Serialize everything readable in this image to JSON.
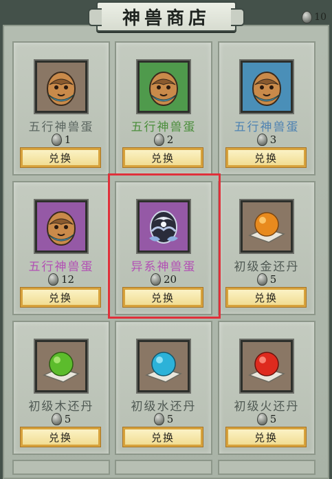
{
  "header": {
    "title": "神兽商店"
  },
  "currency": {
    "icon": "stone-icon",
    "amount": "10"
  },
  "colors": {
    "white_name": "#5b6660",
    "green_name": "#4b8e3c",
    "blue_name": "#4f83b2",
    "purple_name": "#b24fb4",
    "gray_name": "#4f5953",
    "highlight": "#e0303a",
    "button_border": "#d7a23c"
  },
  "items": [
    {
      "name": "五行神兽蛋",
      "price": "1",
      "button": "兑换",
      "icon": "beast-egg-icon",
      "frame_color": "#8a7765",
      "name_color": "#5b6660"
    },
    {
      "name": "五行神兽蛋",
      "price": "2",
      "button": "兑换",
      "icon": "beast-egg-icon",
      "frame_color": "#4f9a4c",
      "name_color": "#4b8e3c"
    },
    {
      "name": "五行神兽蛋",
      "price": "3",
      "button": "兑换",
      "icon": "beast-egg-icon",
      "frame_color": "#4a8fb8",
      "name_color": "#4f83b2"
    },
    {
      "name": "五行神兽蛋",
      "price": "12",
      "button": "兑换",
      "icon": "beast-egg-icon",
      "frame_color": "#9559a6",
      "name_color": "#b24fb4"
    },
    {
      "name": "异系神兽蛋",
      "price": "20",
      "button": "兑换",
      "icon": "alien-beast-egg-icon",
      "frame_color": "#9559a6",
      "name_color": "#b24fb4"
    },
    {
      "name": "初级金还丹",
      "price": "5",
      "button": "兑换",
      "icon": "gold-pill-icon",
      "frame_color": "#8a7765",
      "name_color": "#4f5953"
    },
    {
      "name": "初级木还丹",
      "price": "5",
      "button": "兑换",
      "icon": "wood-pill-icon",
      "frame_color": "#8a7765",
      "name_color": "#4f5953"
    },
    {
      "name": "初级水还丹",
      "price": "5",
      "button": "兑换",
      "icon": "water-pill-icon",
      "frame_color": "#8a7765",
      "name_color": "#4f5953"
    },
    {
      "name": "初级火还丹",
      "price": "5",
      "button": "兑换",
      "icon": "fire-pill-icon",
      "frame_color": "#8a7765",
      "name_color": "#4f5953"
    }
  ]
}
